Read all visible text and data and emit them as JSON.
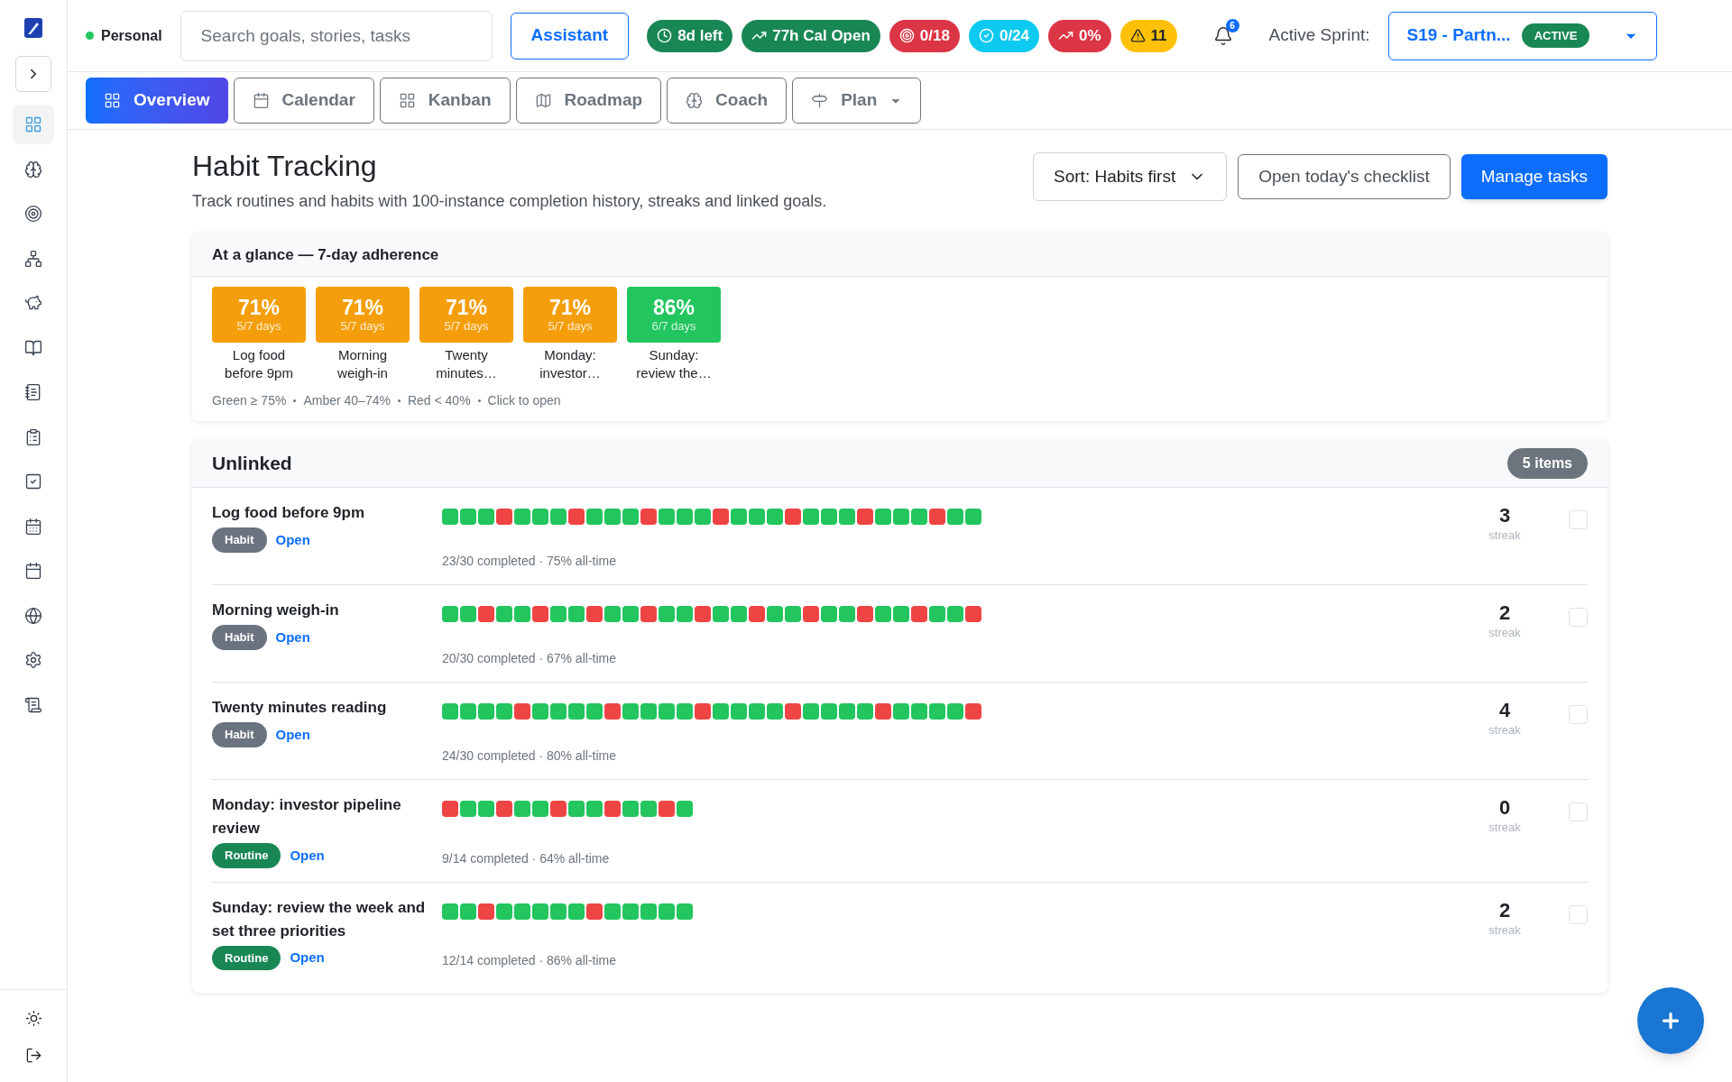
{
  "sidebar": {
    "items": [
      {
        "selected": true
      },
      {
        "selected": false
      },
      {
        "selected": false
      },
      {
        "selected": false
      },
      {
        "selected": false
      },
      {
        "selected": false
      },
      {
        "selected": false
      },
      {
        "selected": false
      },
      {
        "selected": false
      },
      {
        "selected": false
      },
      {
        "selected": false
      },
      {
        "selected": false
      },
      {
        "selected": false
      },
      {
        "selected": false
      }
    ]
  },
  "topbar": {
    "workspace": {
      "name": "Personal",
      "color": "#22c55e"
    },
    "search": {
      "placeholder": "Search goals, stories, tasks"
    },
    "assistant": "Assistant",
    "badges": [
      {
        "kind": "clock",
        "label": "8d left",
        "color": "#198754"
      },
      {
        "kind": "trend",
        "label": "77h Cal Open",
        "color": "#198754"
      },
      {
        "kind": "target",
        "label": "0/18",
        "color": "#dc3545"
      },
      {
        "kind": "check",
        "label": "0/24",
        "color": "#0dcaf0"
      },
      {
        "kind": "trend",
        "label": "0%",
        "color": "#dc3545"
      },
      {
        "kind": "alert",
        "label": "11",
        "color": "#ffc107"
      }
    ],
    "notifications": "6",
    "sprint_label": "Active Sprint:",
    "sprint": {
      "name": "S19 - Partn...",
      "status": "ACTIVE"
    }
  },
  "tabs": [
    {
      "label": "Overview",
      "selected": true,
      "kind": "grid"
    },
    {
      "label": "Calendar",
      "selected": false,
      "kind": "calendar"
    },
    {
      "label": "Kanban",
      "selected": false,
      "kind": "kanban"
    },
    {
      "label": "Roadmap",
      "selected": false,
      "kind": "map"
    },
    {
      "label": "Coach",
      "selected": false,
      "kind": "brain"
    },
    {
      "label": "Plan",
      "selected": false,
      "kind": "signpost"
    }
  ],
  "page": {
    "title": "Habit Tracking",
    "subtitle": "Track routines and habits with 100-instance completion history, streaks and linked goals.",
    "sort": "Sort: Habits first",
    "checklist": "Open today's checklist",
    "manage": "Manage tasks"
  },
  "glance": {
    "title": "At a glance — 7-day adherence",
    "tiles": [
      {
        "percent": "71%",
        "days": "5/7 days",
        "label": "Log food before 9pm",
        "color": "#f59e0b"
      },
      {
        "percent": "71%",
        "days": "5/7 days",
        "label": "Morning weigh-in",
        "color": "#f59e0b"
      },
      {
        "percent": "71%",
        "days": "5/7 days",
        "label": "Twenty minutes…",
        "color": "#f59e0b"
      },
      {
        "percent": "71%",
        "days": "5/7 days",
        "label": "Monday: investor…",
        "color": "#f59e0b"
      },
      {
        "percent": "86%",
        "days": "6/7 days",
        "label": "Sunday: review the…",
        "color": "#22c55e"
      }
    ],
    "legend": [
      "Green ≥ 75%",
      "Amber 40–74%",
      "Red < 40%",
      "Click to open"
    ]
  },
  "group": {
    "title": "Unlinked",
    "count": "5 items",
    "items": [
      {
        "title": "Log food before 9pm",
        "kind": "habit",
        "tag": "Habit",
        "link": "Open",
        "summary": "23/30 completed · 75% all-time",
        "streak": "3",
        "streak_label": "streak",
        "checked": false,
        "history": [
          true,
          true,
          true,
          false,
          true,
          true,
          true,
          false,
          true,
          true,
          true,
          false,
          true,
          true,
          true,
          false,
          true,
          true,
          true,
          false,
          true,
          true,
          true,
          false,
          true,
          true,
          true,
          false,
          true,
          true
        ]
      },
      {
        "title": "Morning weigh-in",
        "kind": "habit",
        "tag": "Habit",
        "link": "Open",
        "summary": "20/30 completed · 67% all-time",
        "streak": "2",
        "streak_label": "streak",
        "checked": false,
        "history": [
          true,
          true,
          false,
          true,
          true,
          false,
          true,
          true,
          false,
          true,
          true,
          false,
          true,
          true,
          false,
          true,
          true,
          false,
          true,
          true,
          false,
          true,
          true,
          false,
          true,
          true,
          false,
          true,
          true,
          false
        ]
      },
      {
        "title": "Twenty minutes reading",
        "kind": "habit",
        "tag": "Habit",
        "link": "Open",
        "summary": "24/30 completed · 80% all-time",
        "streak": "4",
        "streak_label": "streak",
        "checked": false,
        "history": [
          true,
          true,
          true,
          true,
          false,
          true,
          true,
          true,
          true,
          false,
          true,
          true,
          true,
          true,
          false,
          true,
          true,
          true,
          true,
          false,
          true,
          true,
          true,
          true,
          false,
          true,
          true,
          true,
          true,
          false
        ]
      },
      {
        "title": "Monday: investor pipeline review",
        "kind": "routine",
        "tag": "Routine",
        "link": "Open",
        "summary": "9/14 completed · 64% all-time",
        "streak": "0",
        "streak_label": "streak",
        "checked": false,
        "history": [
          false,
          true,
          true,
          false,
          true,
          true,
          false,
          true,
          true,
          false,
          true,
          true,
          false,
          true
        ]
      },
      {
        "title": "Sunday: review the week and set three priorities",
        "kind": "routine",
        "tag": "Routine",
        "link": "Open",
        "summary": "12/14 completed · 86% all-time",
        "streak": "2",
        "streak_label": "streak",
        "checked": false,
        "history": [
          true,
          true,
          false,
          true,
          true,
          true,
          true,
          true,
          false,
          true,
          true,
          true,
          true,
          true
        ]
      }
    ]
  }
}
